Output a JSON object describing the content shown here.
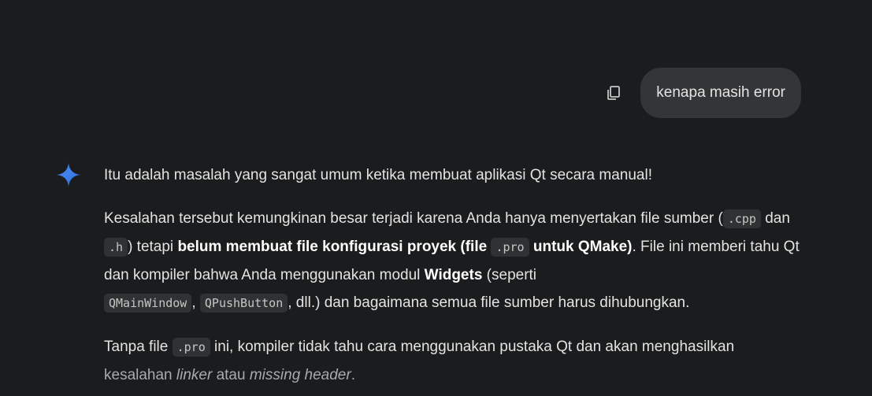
{
  "user_message": {
    "text": "kenapa masih error",
    "copy_icon": "copy-icon"
  },
  "assistant": {
    "icon": "gemini-spark-icon",
    "accent": "#4e8ef7",
    "p1": "Itu adalah masalah yang sangat umum ketika membuat aplikasi Qt secara manual!",
    "p2": {
      "t1": "Kesalahan tersebut kemungkinan besar terjadi karena Anda hanya menyertakan file sumber (",
      "c1": ".cpp",
      "t2": " dan ",
      "c2": ".h",
      "t3": ") tetapi ",
      "b1": "belum membuat file konfigurasi proyek (file ",
      "c3": ".pro",
      "b2": " untuk QMake)",
      "t4": ". File ini memberi tahu Qt dan kompiler bahwa Anda menggunakan modul ",
      "b3": "Widgets",
      "t5": " (seperti ",
      "c4": "QMainWindow",
      "t6": ", ",
      "c5": "QPushButton",
      "t7": ", dll.) dan bagaimana semua file sumber harus dihubungkan."
    },
    "p3": {
      "t1": "Tanpa file ",
      "c1": ".pro",
      "t2": " ini, kompiler tidak tahu cara menggunakan pustaka Qt dan akan menghasilkan",
      "t3": "kesalahan ",
      "i1": "linker",
      "t4": " atau ",
      "i2": "missing header",
      "t5": "."
    }
  }
}
